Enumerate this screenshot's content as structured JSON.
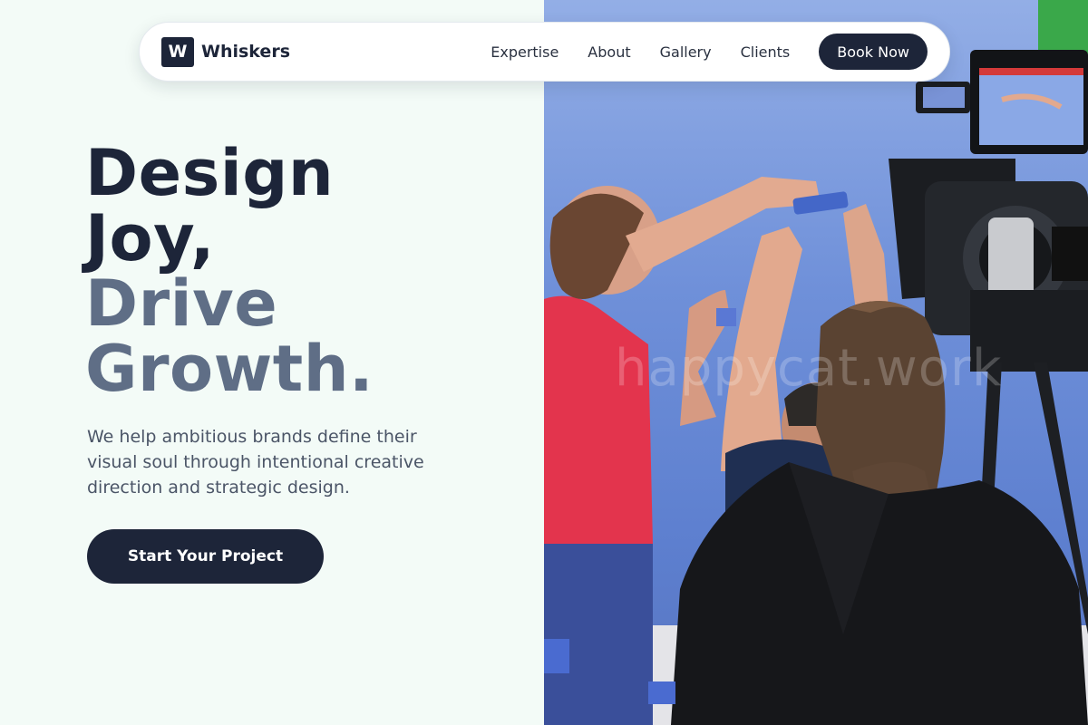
{
  "brand": {
    "mark": "W",
    "name": "Whiskers"
  },
  "nav": {
    "links": [
      "Expertise",
      "About",
      "Gallery",
      "Clients"
    ],
    "cta_label": "Book Now"
  },
  "hero": {
    "headline_lines": [
      {
        "text": "Design",
        "tone": "dark"
      },
      {
        "text": "Joy,",
        "tone": "dark"
      },
      {
        "text": "Drive",
        "tone": "muted"
      },
      {
        "text": "Growth.",
        "tone": "muted"
      }
    ],
    "subtext": "We help ambitious brands define their visual soul through intentional creative direction and strategic design.",
    "cta_label": "Start Your Project"
  },
  "photo": {
    "watermark": "happycat.work",
    "subject": "film-crew-on-blue-screen-set"
  },
  "colors": {
    "primary": "#1d2539",
    "muted_heading": "#5f6e86",
    "body_text": "#4b5567",
    "page_bg": "#f3fbf7"
  }
}
